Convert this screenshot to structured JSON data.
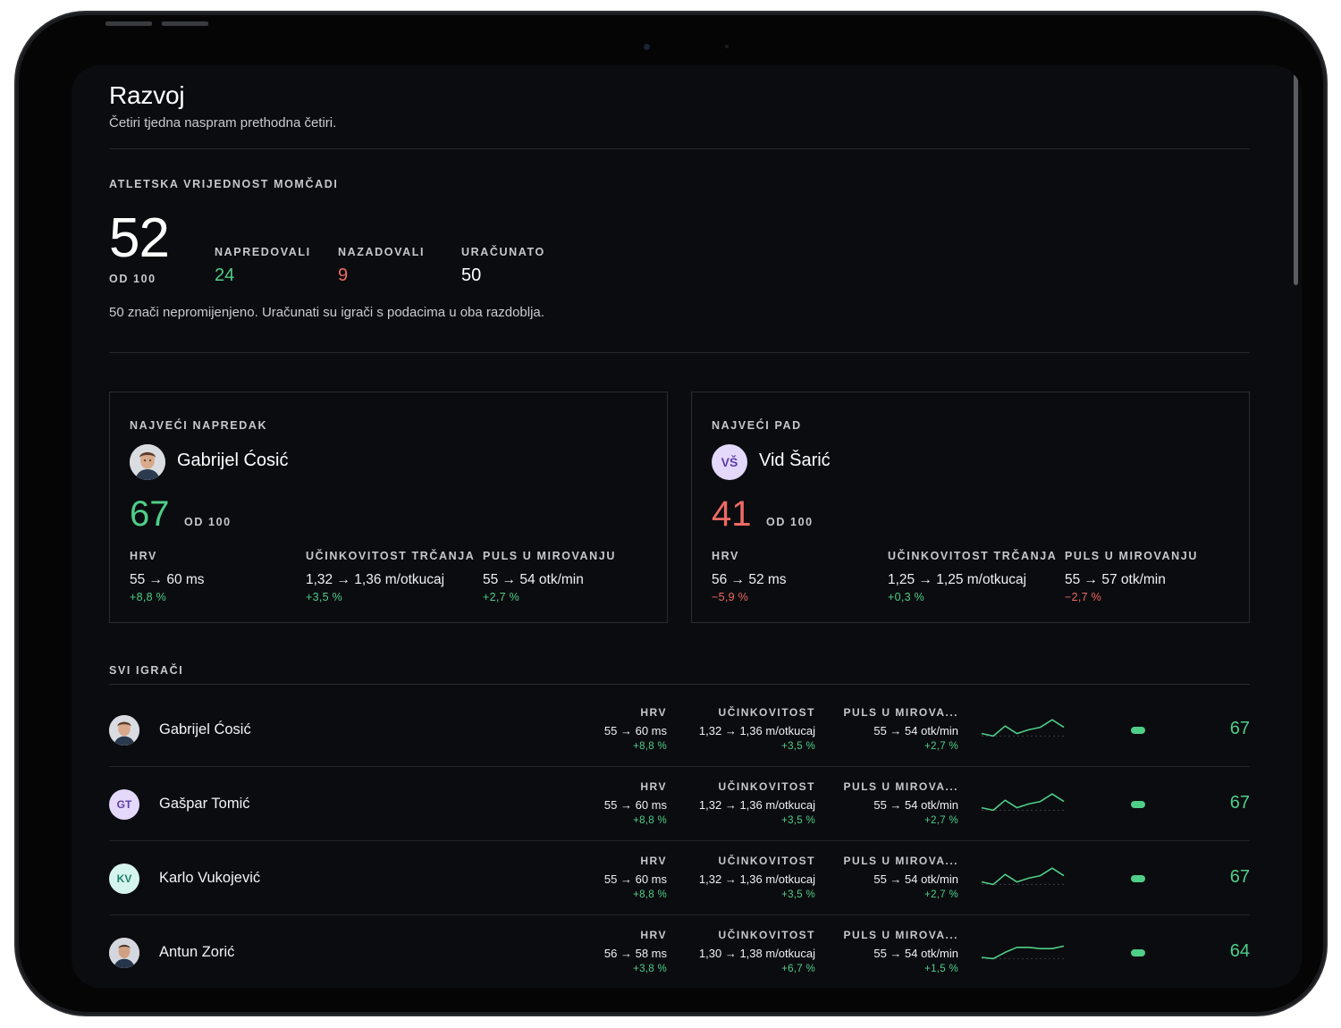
{
  "header": {
    "title": "Razvoj",
    "subtitle": "Četiri tjedna naspram prethodna četiri."
  },
  "team": {
    "label": "ATLETSKA VRIJEDNOST MOMČADI",
    "score": "52",
    "out_of": "OD 100",
    "stats": [
      {
        "label": "NAPREDOVALI",
        "value": "24",
        "tone": "green"
      },
      {
        "label": "NAZADOVALI",
        "value": "9",
        "tone": "red"
      },
      {
        "label": "URAČUNATO",
        "value": "50",
        "tone": "neutral"
      }
    ],
    "note": "50 znači nepromijenjeno. Uračunati su igrači s podacima u oba razdoblja."
  },
  "highlights": [
    {
      "label": "NAJVEĆI NAPREDAK",
      "name": "Gabrijel Ćosić",
      "avatar": "photo",
      "score": "67",
      "out_of": "OD 100",
      "tone": "green",
      "metrics": [
        {
          "label": "HRV",
          "value": "55 → 60 ms",
          "delta": "+8,8 %",
          "tone": "green"
        },
        {
          "label": "UČINKOVITOST TRČANJA",
          "value": "1,32 → 1,36 m/otkucaj",
          "delta": "+3,5 %",
          "tone": "green"
        },
        {
          "label": "PULS U MIROVANJU",
          "value": "55 → 54 otk/min",
          "delta": "+2,7 %",
          "tone": "green"
        }
      ]
    },
    {
      "label": "NAJVEĆI PAD",
      "name": "Vid Šarić",
      "avatar": "VŠ",
      "avatar_color": "#e4d8fb",
      "avatar_text_color": "#5b3fa6",
      "score": "41",
      "out_of": "OD 100",
      "tone": "red",
      "metrics": [
        {
          "label": "HRV",
          "value": "56 → 52 ms",
          "delta": "−5,9 %",
          "tone": "red"
        },
        {
          "label": "UČINKOVITOST TRČANJA",
          "value": "1,25 → 1,25 m/otkucaj",
          "delta": "+0,3 %",
          "tone": "green"
        },
        {
          "label": "PULS U MIROVANJU",
          "value": "55 → 57 otk/min",
          "delta": "−2,7 %",
          "tone": "red"
        }
      ]
    }
  ],
  "players": {
    "label": "SVI IGRAČI",
    "rows": [
      {
        "name": "Gabrijel Ćosić",
        "avatar": "photo",
        "hrv": {
          "label": "HRV",
          "value": "55 → 60 ms",
          "delta": "+8,8 %"
        },
        "run": {
          "label": "UČINKOVITOST",
          "value": "1,32 → 1,36 m/otkucaj",
          "delta": "+3,5 %"
        },
        "pulse": {
          "label": "PULS U MIROVA...",
          "value": "55 → 54 otk/min",
          "delta": "+2,7 %"
        },
        "trend": [
          52,
          50,
          58,
          52,
          55,
          57,
          63,
          57
        ],
        "score": "67"
      },
      {
        "name": "Gašpar Tomić",
        "avatar": "GT",
        "avatar_color": "#e4d8fb",
        "avatar_text_color": "#5b3fa6",
        "hrv": {
          "label": "HRV",
          "value": "55 → 60 ms",
          "delta": "+8,8 %"
        },
        "run": {
          "label": "UČINKOVITOST",
          "value": "1,32 → 1,36 m/otkucaj",
          "delta": "+3,5 %"
        },
        "pulse": {
          "label": "PULS U MIROVA...",
          "value": "55 → 54 otk/min",
          "delta": "+2,7 %"
        },
        "trend": [
          52,
          50,
          58,
          52,
          55,
          57,
          63,
          57
        ],
        "score": "67"
      },
      {
        "name": "Karlo Vukojević",
        "avatar": "KV",
        "avatar_color": "#d6f4ee",
        "avatar_text_color": "#23806b",
        "hrv": {
          "label": "HRV",
          "value": "55 → 60 ms",
          "delta": "+8,8 %"
        },
        "run": {
          "label": "UČINKOVITOST",
          "value": "1,32 → 1,36 m/otkucaj",
          "delta": "+3,5 %"
        },
        "pulse": {
          "label": "PULS U MIROVA...",
          "value": "55 → 54 otk/min",
          "delta": "+2,7 %"
        },
        "trend": [
          52,
          50,
          58,
          52,
          55,
          57,
          63,
          57
        ],
        "score": "67"
      },
      {
        "name": "Antun Zorić",
        "avatar": "photo",
        "hrv": {
          "label": "HRV",
          "value": "56 → 58 ms",
          "delta": "+3,8 %"
        },
        "run": {
          "label": "UČINKOVITOST",
          "value": "1,30 → 1,38 m/otkucaj",
          "delta": "+6,7 %"
        },
        "pulse": {
          "label": "PULS U MIROVA...",
          "value": "55 → 54 otk/min",
          "delta": "+1,5 %"
        },
        "trend": [
          51,
          50,
          55,
          59,
          59,
          58,
          58,
          60
        ],
        "score": "64"
      }
    ]
  }
}
